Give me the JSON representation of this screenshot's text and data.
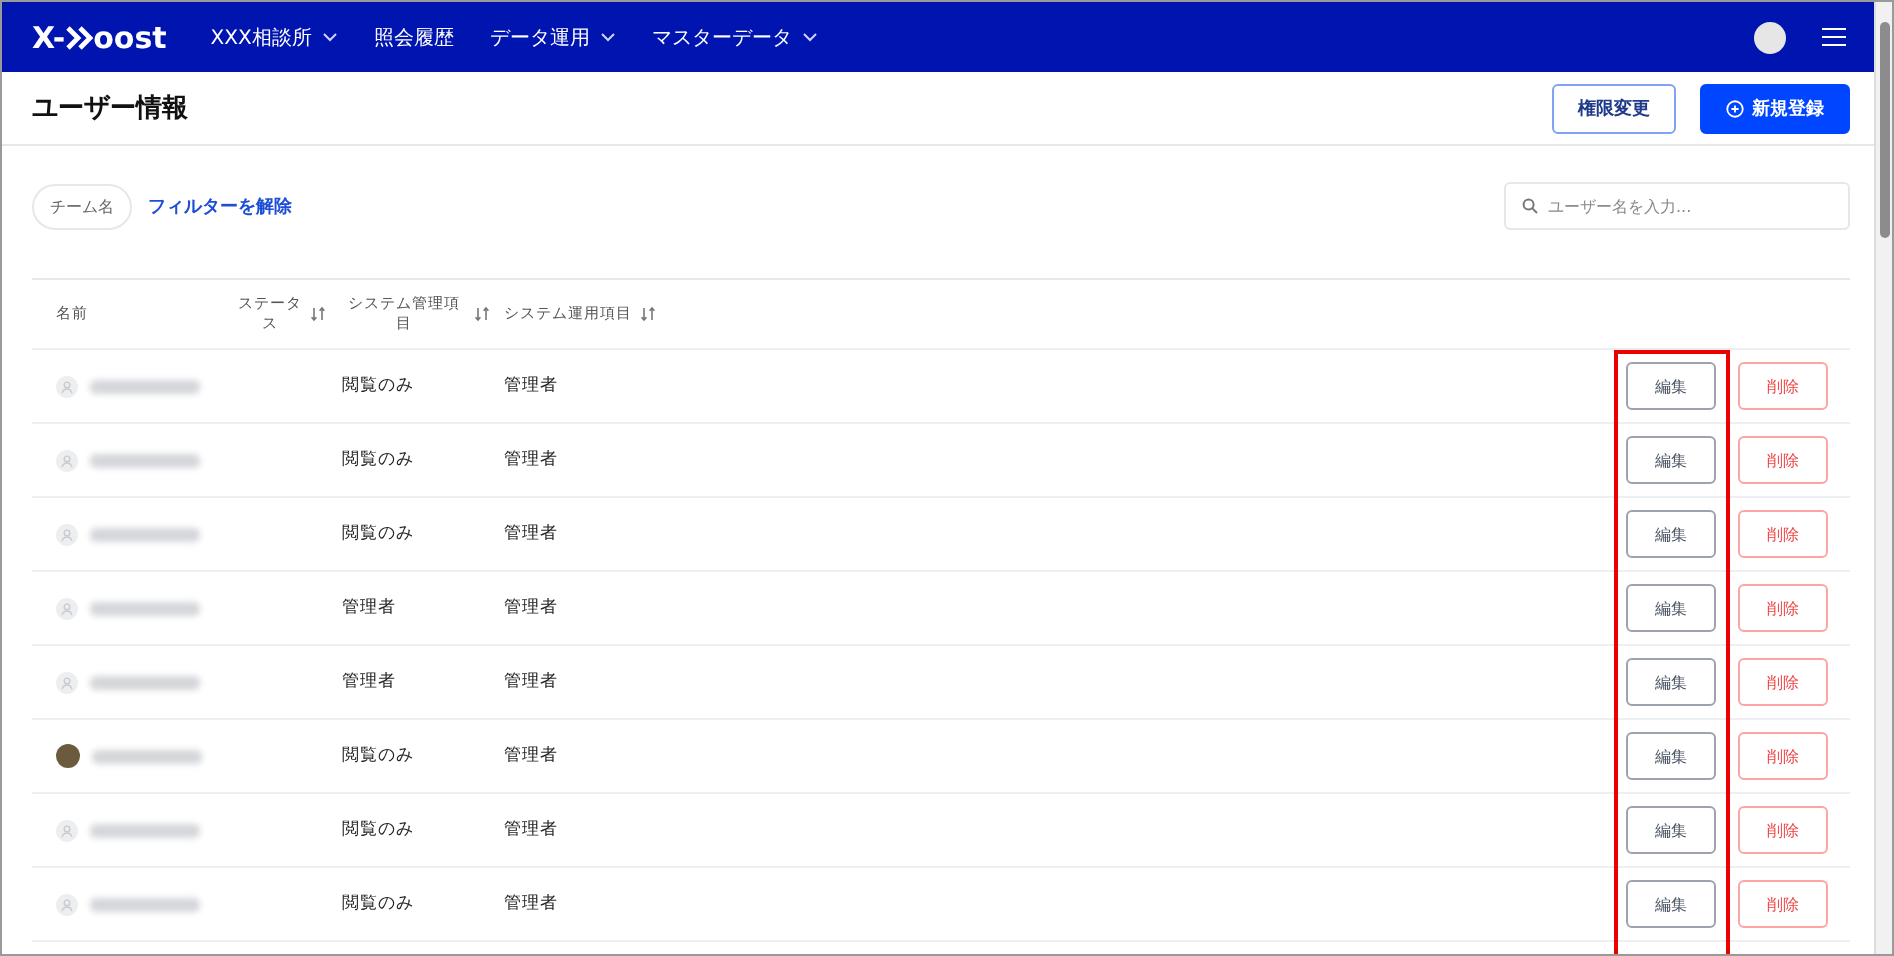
{
  "nav": {
    "logo": {
      "prefix": "X-",
      "suffix": "oost"
    },
    "items": [
      {
        "label": "XXX相談所",
        "has_menu": true
      },
      {
        "label": "照会履歴",
        "has_menu": false
      },
      {
        "label": "データ運用",
        "has_menu": true
      },
      {
        "label": "マスターデータ",
        "has_menu": true
      }
    ]
  },
  "page": {
    "title": "ユーザー情報",
    "buttons": [
      {
        "label": "権限変更",
        "kind": "outline"
      },
      {
        "label": "新規登録",
        "kind": "primary"
      }
    ]
  },
  "filters": {
    "chip": "チーム名",
    "clear_link": "フィルターを解除",
    "search": {
      "placeholder": "ユーザー名を入力..."
    }
  },
  "table": {
    "columns": [
      {
        "label": "名前",
        "sortable": false
      },
      {
        "label": "ステータス",
        "sortable": true
      },
      {
        "label": "システム管理項目",
        "sortable": true
      },
      {
        "label": "システム運用項目",
        "sortable": true
      }
    ],
    "rows": [
      {
        "has_photo": false,
        "system_admin": "閲覧のみ",
        "system_ops": "管理者",
        "edit": "編集",
        "delete": "削除"
      },
      {
        "has_photo": false,
        "system_admin": "閲覧のみ",
        "system_ops": "管理者",
        "edit": "編集",
        "delete": "削除"
      },
      {
        "has_photo": false,
        "system_admin": "閲覧のみ",
        "system_ops": "管理者",
        "edit": "編集",
        "delete": "削除"
      },
      {
        "has_photo": false,
        "system_admin": "管理者",
        "system_ops": "管理者",
        "edit": "編集",
        "delete": "削除"
      },
      {
        "has_photo": false,
        "system_admin": "管理者",
        "system_ops": "管理者",
        "edit": "編集",
        "delete": "削除"
      },
      {
        "has_photo": true,
        "system_admin": "閲覧のみ",
        "system_ops": "管理者",
        "edit": "編集",
        "delete": "削除"
      },
      {
        "has_photo": false,
        "system_admin": "閲覧のみ",
        "system_ops": "管理者",
        "edit": "編集",
        "delete": "削除"
      },
      {
        "has_photo": false,
        "system_admin": "閲覧のみ",
        "system_ops": "管理者",
        "edit": "編集",
        "delete": "削除"
      }
    ]
  }
}
